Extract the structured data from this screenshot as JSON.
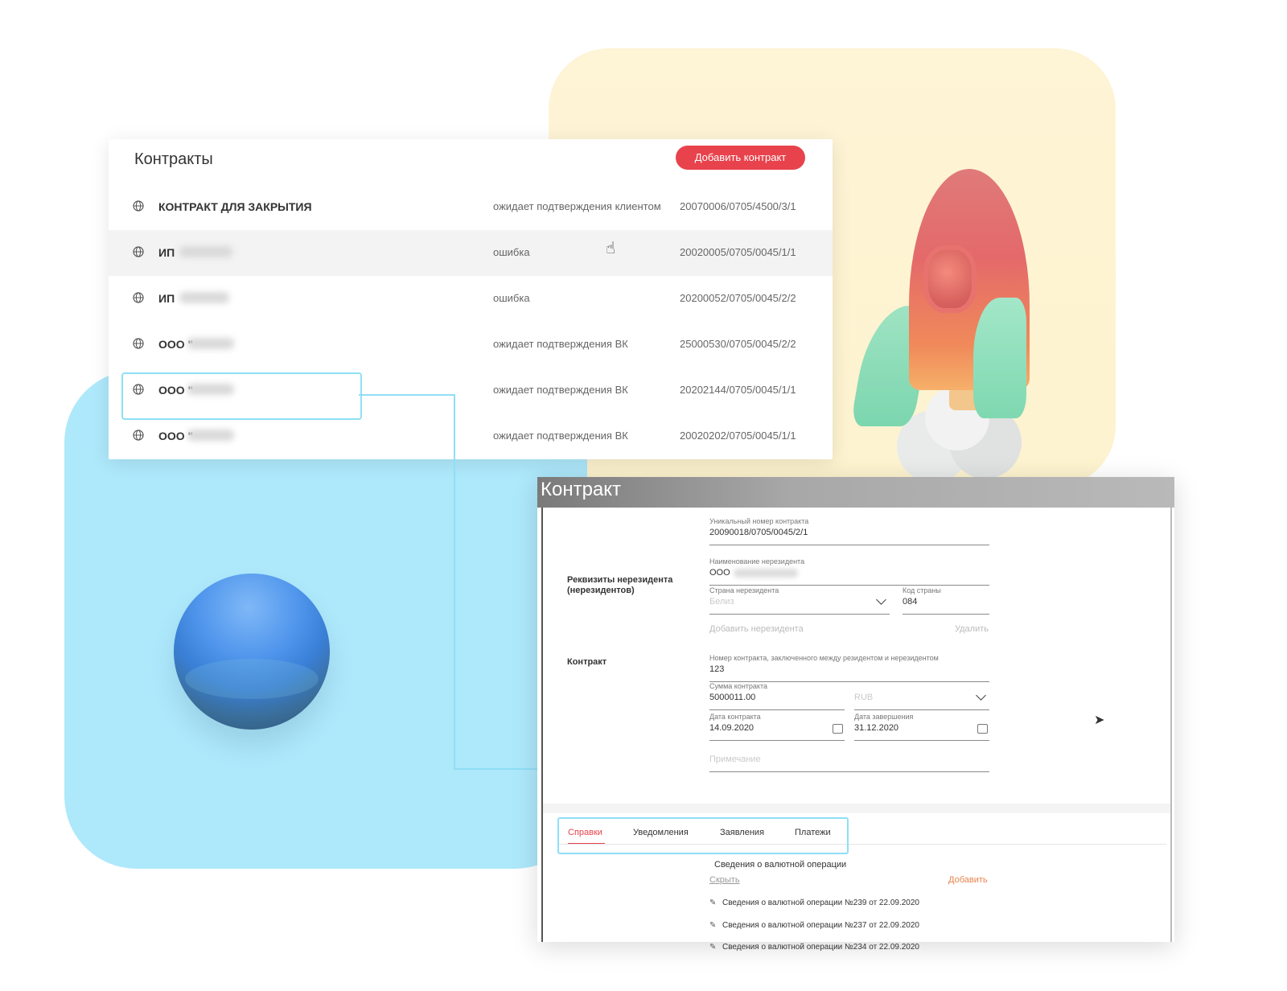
{
  "list": {
    "title": "Контракты",
    "add_button": "Добавить контракт",
    "rows": [
      {
        "name": "КОНТРАКТ ДЛЯ ЗАКРЫТИЯ",
        "status": "ожидает подтверждения клиентом",
        "number": "20070006/0705/4500/3/1"
      },
      {
        "name": "ИП",
        "status": "ошибка",
        "number": "20020005/0705/0045/1/1"
      },
      {
        "name": "ИП",
        "status": "ошибка",
        "number": "20200052/0705/0045/2/2"
      },
      {
        "name": "ООО \"",
        "status": "ожидает подтверждения ВК",
        "number": "25000530/0705/0045/2/2"
      },
      {
        "name": "ООО \"",
        "status": "ожидает подтверждения ВК",
        "number": "20202144/0705/0045/1/1"
      },
      {
        "name": "ООО \"",
        "status": "ожидает подтверждения ВК",
        "number": "20020202/0705/0045/1/1"
      }
    ]
  },
  "detail": {
    "title": "Контракт",
    "unique_number": {
      "label": "Уникальный номер контракта",
      "value": "20090018/0705/0045/2/1"
    },
    "nonresident_section": "Реквизиты нерезидента (нерезидентов)",
    "nonresident_name": {
      "label": "Наименование нерезидента",
      "value": "ООО"
    },
    "country": {
      "label": "Страна нерезидента",
      "value": "Белиз"
    },
    "country_code": {
      "label": "Код страны",
      "value": "084"
    },
    "add_nonresident": "Добавить нерезидента",
    "delete": "Удалить",
    "contract_section": "Контракт",
    "contract_number": {
      "label": "Номер контракта, заключенного между резидентом и нерезидентом",
      "value": "123"
    },
    "amount": {
      "label": "Сумма контракта",
      "value": "5000011.00"
    },
    "currency": {
      "value": "RUB"
    },
    "contract_date": {
      "label": "Дата контракта",
      "value": "14.09.2020"
    },
    "end_date": {
      "label": "Дата завершения",
      "value": "31.12.2020"
    },
    "note": {
      "placeholder": "Примечание"
    },
    "tabs": [
      "Справки",
      "Уведомления",
      "Заявления",
      "Платежи"
    ],
    "subsection_title": "Сведения о валютной операции",
    "hide_link": "Скрыть",
    "add_link": "Добавить",
    "items": [
      "Сведения о валютной операции №239 от 22.09.2020",
      "Сведения о валютной операции №237 от 22.09.2020",
      "Сведения о валютной операции №234 от 22.09.2020"
    ]
  },
  "colors": {
    "accent": "#e8434c",
    "highlight": "#8fdff5",
    "bg_blue": "#aee8fb",
    "bg_yellow": "#fdf4d2"
  },
  "icons": [
    "globe-icon",
    "hand-pointer-icon",
    "chevron-down-icon",
    "calendar-icon",
    "pencil-icon",
    "cursor-arrow-icon"
  ]
}
